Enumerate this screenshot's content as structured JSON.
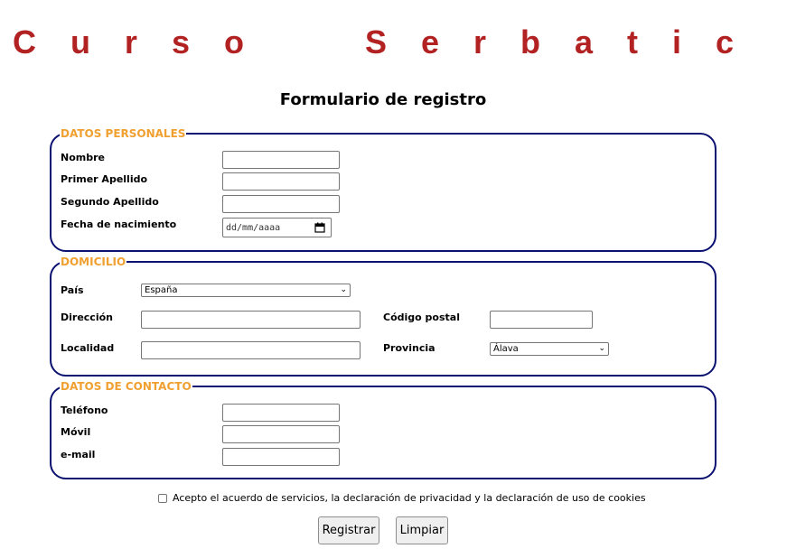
{
  "header": {
    "site_title": "C u r s o     S e r b a t i c",
    "form_title": "Formulario de registro"
  },
  "personal": {
    "legend": "DATOS PERSONALES",
    "nombre_label": "Nombre",
    "apellido1_label": "Primer Apellido",
    "apellido2_label": "Segundo Apellido",
    "fecha_label": "Fecha de nacimiento",
    "fecha_placeholder": "dd/mm/aaaa"
  },
  "domicilio": {
    "legend": "DOMICILIO",
    "pais_label": "País",
    "pais_value": "España",
    "direccion_label": "Dirección",
    "cp_label": "Código postal",
    "localidad_label": "Localidad",
    "provincia_label": "Provincia",
    "provincia_value": "Álava"
  },
  "contacto": {
    "legend": "DATOS DE CONTACTO",
    "telefono_label": "Teléfono",
    "movil_label": "Móvil",
    "email_label": "e-mail"
  },
  "consent": {
    "text": "Acepto el acuerdo de servicios, la declaración de privacidad y la declaración de uso de cookies",
    "checked": false
  },
  "actions": {
    "submit_label": "Registrar",
    "reset_label": "Limpiar"
  },
  "colors": {
    "title": "#b22222",
    "legend": "#f0a030",
    "border": "#0b1170"
  }
}
